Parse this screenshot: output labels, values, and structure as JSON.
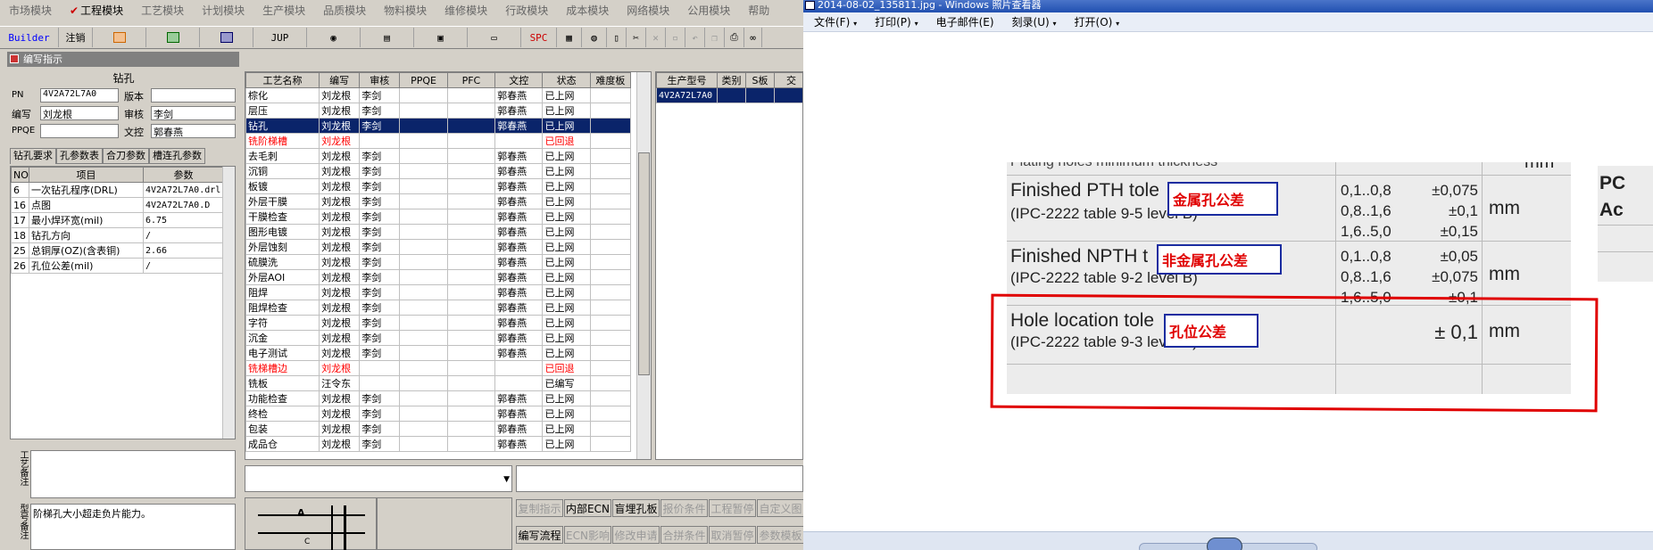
{
  "menubar": {
    "items": [
      "市场模块",
      "工程模块",
      "工艺模块",
      "计划模块",
      "生产模块",
      "品质模块",
      "物料模块",
      "维修模块",
      "行政模块",
      "成本模块",
      "网络模块",
      "公用模块",
      "帮助"
    ]
  },
  "toolbar": {
    "builder": "Builder",
    "logout": "注销",
    "jup": "JUP",
    "spc": "SPC"
  },
  "write_panel": {
    "title": "编写指示",
    "section": "钻孔",
    "fields": {
      "pn_label": "PN",
      "pn_value": "4V2A72L7A0",
      "version_label": "版本",
      "version_value": "",
      "editor_label": "编写",
      "editor_value": "刘龙根",
      "reviewer_label": "审核",
      "reviewer_value": "李剑",
      "ppqe_label": "PPQE",
      "ppqe_value": "",
      "doc_label": "文控",
      "doc_value": "郭春燕"
    },
    "tabs": [
      "钻孔要求",
      "孔参数表",
      "合刀参数",
      "槽连孔参数"
    ],
    "param_headers": [
      "NO",
      "项目",
      "参数"
    ],
    "params": [
      [
        "6",
        "一次钻孔程序(DRL)",
        "4V2A72L7A0.drl"
      ],
      [
        "16",
        "点图",
        "4V2A72L7A0.D"
      ],
      [
        "17",
        "最小焊环宽(mil)",
        "6.75"
      ],
      [
        "18",
        "钻孔方向",
        "/"
      ],
      [
        "25",
        "总铜厚(OZ)(含表铜)",
        "2.66"
      ],
      [
        "26",
        "孔位公差(mil)",
        "/"
      ]
    ],
    "note_label": "工艺备注",
    "note_text": "",
    "remark_label": "型号备注",
    "remark_text": "阶梯孔大小超走负片能力。"
  },
  "process_table": {
    "headers": [
      "工艺名称",
      "编写",
      "审核",
      "PPQE",
      "PFC",
      "文控",
      "状态",
      "难度板"
    ],
    "rows": [
      [
        "棕化",
        "刘龙根",
        "李剑",
        "",
        "",
        "郭春燕",
        "已上网",
        ""
      ],
      [
        "层压",
        "刘龙根",
        "李剑",
        "",
        "",
        "郭春燕",
        "已上网",
        ""
      ],
      [
        "钻孔",
        "刘龙根",
        "李剑",
        "",
        "",
        "郭春燕",
        "已上网",
        ""
      ],
      [
        "铣阶梯槽",
        "刘龙根",
        "",
        "",
        "",
        "",
        "已回退",
        ""
      ],
      [
        "去毛刺",
        "刘龙根",
        "李剑",
        "",
        "",
        "郭春燕",
        "已上网",
        ""
      ],
      [
        "沉铜",
        "刘龙根",
        "李剑",
        "",
        "",
        "郭春燕",
        "已上网",
        ""
      ],
      [
        "板镀",
        "刘龙根",
        "李剑",
        "",
        "",
        "郭春燕",
        "已上网",
        ""
      ],
      [
        "外层干膜",
        "刘龙根",
        "李剑",
        "",
        "",
        "郭春燕",
        "已上网",
        ""
      ],
      [
        "干膜检查",
        "刘龙根",
        "李剑",
        "",
        "",
        "郭春燕",
        "已上网",
        ""
      ],
      [
        "图形电镀",
        "刘龙根",
        "李剑",
        "",
        "",
        "郭春燕",
        "已上网",
        ""
      ],
      [
        "外层蚀刻",
        "刘龙根",
        "李剑",
        "",
        "",
        "郭春燕",
        "已上网",
        ""
      ],
      [
        "硫膜洗",
        "刘龙根",
        "李剑",
        "",
        "",
        "郭春燕",
        "已上网",
        ""
      ],
      [
        "外层AOI",
        "刘龙根",
        "李剑",
        "",
        "",
        "郭春燕",
        "已上网",
        ""
      ],
      [
        "阻焊",
        "刘龙根",
        "李剑",
        "",
        "",
        "郭春燕",
        "已上网",
        ""
      ],
      [
        "阻焊检查",
        "刘龙根",
        "李剑",
        "",
        "",
        "郭春燕",
        "已上网",
        ""
      ],
      [
        "字符",
        "刘龙根",
        "李剑",
        "",
        "",
        "郭春燕",
        "已上网",
        ""
      ],
      [
        "沉金",
        "刘龙根",
        "李剑",
        "",
        "",
        "郭春燕",
        "已上网",
        ""
      ],
      [
        "电子测试",
        "刘龙根",
        "李剑",
        "",
        "",
        "郭春燕",
        "已上网",
        ""
      ],
      [
        "铣梯槽边",
        "刘龙根",
        "",
        "",
        "",
        "",
        "已回退",
        ""
      ],
      [
        "铣板",
        "汪令东",
        "",
        "",
        "",
        "",
        "已编写",
        ""
      ],
      [
        "功能检查",
        "刘龙根",
        "李剑",
        "",
        "",
        "郭春燕",
        "已上网",
        ""
      ],
      [
        "终检",
        "刘龙根",
        "李剑",
        "",
        "",
        "郭春燕",
        "已上网",
        ""
      ],
      [
        "包装",
        "刘龙根",
        "李剑",
        "",
        "",
        "郭春燕",
        "已上网",
        ""
      ],
      [
        "成品仓",
        "刘龙根",
        "李剑",
        "",
        "",
        "郭春燕",
        "已上网",
        ""
      ]
    ]
  },
  "model_table": {
    "headers": [
      "生产型号",
      "类别",
      "S板",
      "交"
    ],
    "rows": [
      [
        "4V2A72L7A0",
        "",
        "",
        ""
      ]
    ]
  },
  "buttons": {
    "row1": [
      "复制指示",
      "内部ECN",
      "盲埋孔板",
      "报价条件",
      "工程暂停",
      "自定义图"
    ],
    "row2": [
      "编写流程",
      "ECN影响",
      "修改申请",
      "合拼条件",
      "取消暂停",
      "参数模板"
    ]
  },
  "diagram": {
    "label_a": "A",
    "label_c": "C"
  },
  "viewer": {
    "title": "2014-08-02_135811.jpg - Windows 照片查看器",
    "menu": [
      "文件(F)",
      "打印(P)",
      "电子邮件(E)",
      "刻录(U)",
      "打开(O)"
    ],
    "doc": {
      "cut_top": "Plating holes minimum thickness",
      "cut_top_mm": "mm",
      "rows": [
        {
          "title": "Finished PTH tole",
          "subtitle": "(IPC-2222 table 9-5 level B)",
          "ranges": [
            "0,1..0,8",
            "0,8..1,6",
            "1,6..5,0"
          ],
          "tols": [
            "±0,075",
            "±0,1",
            "±0,15"
          ],
          "unit": "mm",
          "cn": "金属孔公差"
        },
        {
          "title": "Finished NPTH t",
          "subtitle": "(IPC-2222 table 9-2 level B)",
          "ranges": [
            "0,1..0,8",
            "0,8..1,6",
            "1,6..5,0"
          ],
          "tols": [
            "±0,05",
            "±0,075",
            "±0,1"
          ],
          "unit": "mm",
          "cn": "非金属孔公差"
        },
        {
          "title": "Hole location tole",
          "subtitle": "(IPC-2222 table 9-3 level B)",
          "tol": "± 0,1",
          "unit": "mm",
          "cn": "孔位公差"
        }
      ],
      "side1": "PC",
      "side2": "Ac"
    }
  },
  "colors": {
    "selection": "#0a246a",
    "highlight_box": "#e00000",
    "label_border": "#1a2ca0"
  }
}
